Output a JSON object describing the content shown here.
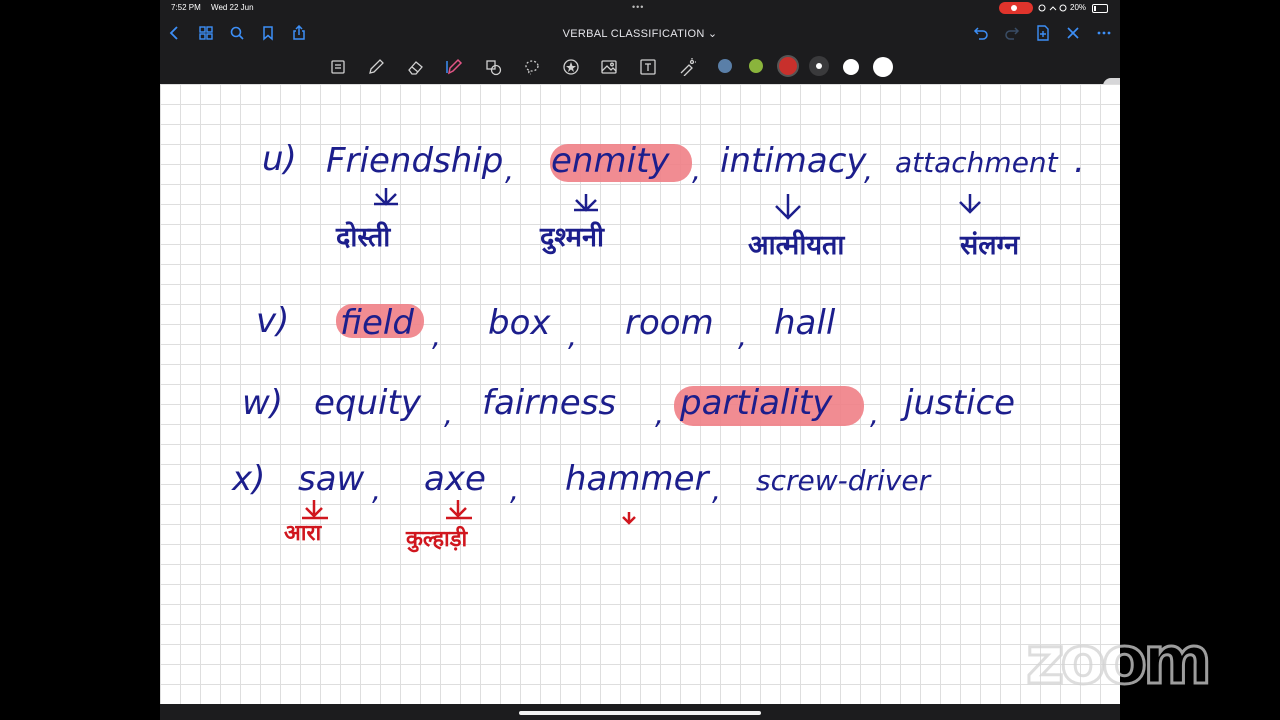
{
  "status": {
    "time": "7:52 PM",
    "date": "Wed 22 Jun",
    "battery": "20%",
    "battery_level": 0.2
  },
  "doc": {
    "title": "VERBAL CLASSIFICATION ⌄"
  },
  "icons": [
    "back-icon",
    "grid-icon",
    "search-icon",
    "bookmark-icon",
    "share-icon",
    "undo-icon",
    "redo-icon",
    "add-page-icon",
    "close-icon",
    "more-icon"
  ],
  "toolbar": {
    "tools": [
      "reader-icon",
      "pen-icon",
      "eraser-icon",
      "highlighter-icon",
      "shapes-icon",
      "lasso-icon",
      "sticker-icon",
      "image-icon",
      "text-icon",
      "laser-icon"
    ],
    "swatches": [
      "#5a7fa8",
      "#8ab43c",
      "#c8302c",
      "#ffffff",
      "#ffffff",
      "#ffffff"
    ]
  },
  "notes": {
    "q4": {
      "num": "u)",
      "w1": "Friendship",
      "w2": "enmity",
      "w3": "intimacy",
      "w4": "attachment",
      "end": ".",
      "h1": "दोस्ती",
      "h2": "दुश्मनी",
      "h3": "आत्मीयता",
      "h4": "संलग्न"
    },
    "q5": {
      "num": "v)",
      "w1": "field",
      "w2": "box",
      "w3": "room",
      "w4": "hall"
    },
    "q6": {
      "num": "w)",
      "w1": "equity",
      "w2": "fairness",
      "w3": "partiality",
      "w4": "justice"
    },
    "q7": {
      "num": "x)",
      "w1": "saw",
      "w2": "axe",
      "w3": "hammer",
      "w4": "screw-driver",
      "h1": "आरा",
      "h2": "कुल्हाड़ी"
    }
  },
  "colors": {
    "ink_blue": "#1c1e8c",
    "ink_red": "#d0161e",
    "highlight": "#ef7f86"
  },
  "overlay": {
    "logo": "zoom"
  }
}
